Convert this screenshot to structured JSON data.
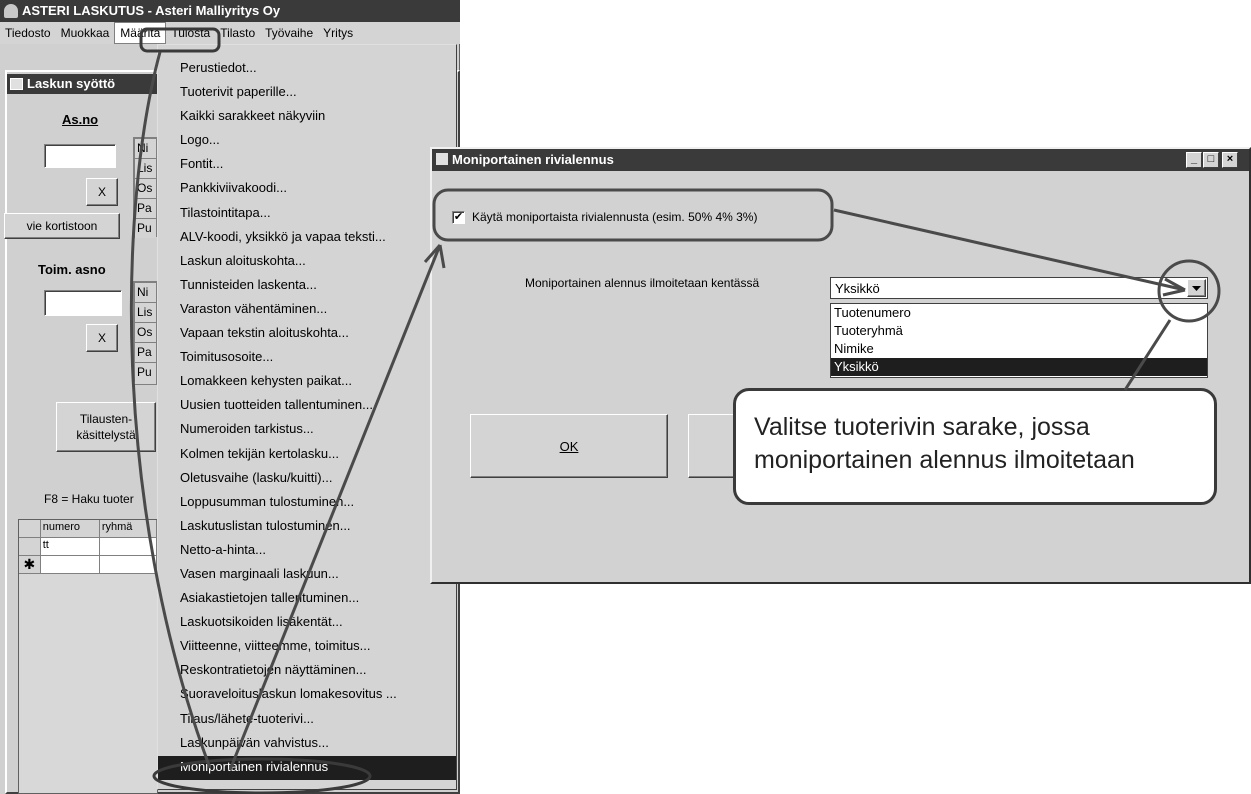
{
  "main_window": {
    "title": "ASTERI LASKUTUS - Asteri Malliyritys Oy",
    "menubar": [
      "Tiedosto",
      "Muokkaa",
      "Määritä",
      "Tulosta",
      "Tilasto",
      "Työvaihe",
      "Yritys"
    ]
  },
  "child_window": {
    "title": "Laskun syöttö",
    "asno_label": "As.no",
    "x_label": "X",
    "vie_kortistoon": "vie kortistoon",
    "toim_asno_label": "Toim. asno",
    "x_label2": "X",
    "tilausten_button": "Tilausten- käsittelystä",
    "f8_text": "F8 = Haku tuoter",
    "side_boxes_1": [
      "Ni",
      "Lis",
      "Os",
      "Pa",
      "Pu"
    ],
    "side_boxes_2": [
      "Ni",
      "Lis",
      "Os",
      "Pa",
      "Pu"
    ]
  },
  "grid": {
    "headers": [
      "numero",
      "ryhmä"
    ],
    "rows": [
      [
        "tt",
        ""
      ],
      [
        "",
        ""
      ]
    ],
    "new_row_marker": "✱"
  },
  "dropdown_menu": {
    "items": [
      "Perustiedot...",
      "Tuoterivit paperille...",
      "Kaikki sarakkeet näkyviin",
      "Logo...",
      "Fontit...",
      "Pankkiviivakoodi...",
      "Tilastointitapa...",
      "ALV-koodi, yksikkö ja vapaa teksti...",
      "Laskun aloituskohta...",
      "Tunnisteiden laskenta...",
      "Varaston vähentäminen...",
      "Vapaan tekstin aloituskohta...",
      "Toimitusosoite...",
      "Lomakkeen kehysten paikat...",
      "Uusien tuotteiden tallentuminen...",
      "Numeroiden tarkistus...",
      "Kolmen tekijän kertolasku...",
      "Oletusvaihe (lasku/kuitti)...",
      "Loppusumman tulostuminen...",
      "Laskutuslistan tulostuminen...",
      "Netto-a-hinta...",
      "Vasen marginaali laskuun...",
      "Asiakastietojen tallentuminen...",
      "Laskuotsikoiden lisäkentät...",
      "Viitteenne, viitteemme, toimitus...",
      "Reskontratietojen näyttäminen...",
      "Suoraveloituslaskun lomakesovitus ...",
      "Tilaus/lähete-tuoterivi...",
      "Laskunpäivän vahvistus...",
      "Moniportainen rivialennus"
    ],
    "selected_index": 29
  },
  "dialog": {
    "title": "Moniportainen rivialennus",
    "checkbox_label": "Käytä moniportaista rivialennusta (esim. 50% 4% 3%)",
    "checkbox_checked": "✔",
    "field_label": "Moniportainen alennus ilmoitetaan kentässä",
    "combo_value": "Yksikkö",
    "combo_options": [
      "Tuotenumero",
      "Tuoteryhmä",
      "Nimike",
      "Yksikkö"
    ],
    "ok_label": "OK",
    "minimize": "_",
    "maximize": "□",
    "close": "×"
  },
  "callout": {
    "line1": "Valitse tuoterivin sarake, jossa",
    "line2": "moniportainen alennus ilmoitetaan"
  }
}
